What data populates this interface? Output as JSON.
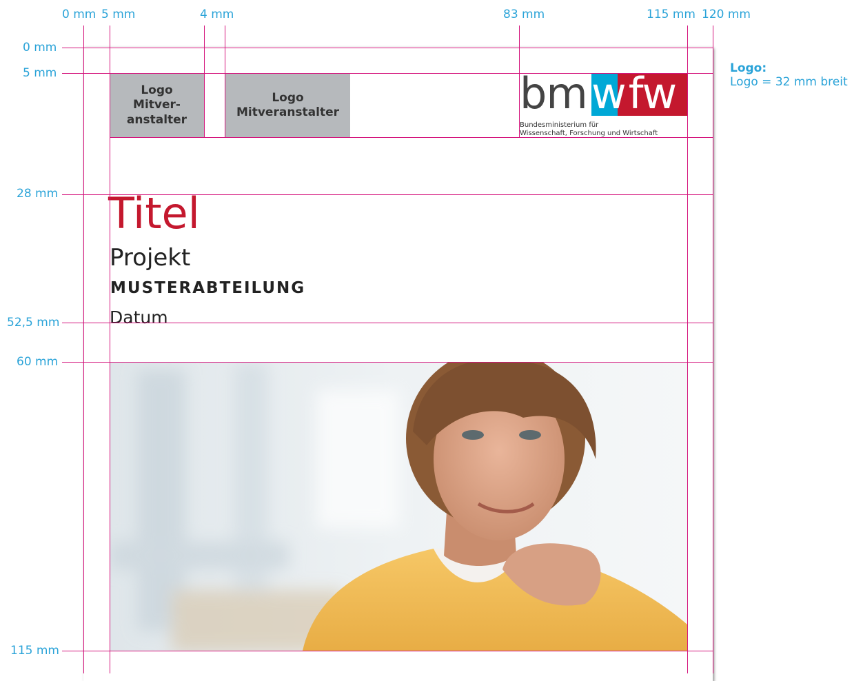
{
  "top_ruler": [
    "0 mm",
    "5 mm",
    "4 mm",
    "83 mm",
    "115 mm",
    "120 mm"
  ],
  "left_ruler": [
    "0 mm",
    "5 mm",
    "28 mm",
    "52,5 mm",
    "60 mm",
    "115 mm"
  ],
  "note": {
    "heading": "Logo:",
    "text": "Logo = 32 mm breit"
  },
  "partner_logo_1": "Logo Mitver-anstalter",
  "partner_logo_2": "Logo Mitveranstalter",
  "brand": {
    "wordmark_dark": "bm",
    "wordmark_blue": "w",
    "wordmark_red": "fw",
    "line1": "Bundesministerium für",
    "line2": "Wissenschaft, Forschung und Wirtschaft",
    "colors": {
      "blue": "#00a8d6",
      "red": "#c4182e",
      "dark": "#444444"
    }
  },
  "cover": {
    "title": "Titel",
    "project": "Projekt",
    "department": "MUSTERABTEILUNG",
    "date": "Datum"
  },
  "accent": {
    "title_color": "#c4182e",
    "guide_color": "#d4147c",
    "ruler_color": "#2aa3d8"
  }
}
